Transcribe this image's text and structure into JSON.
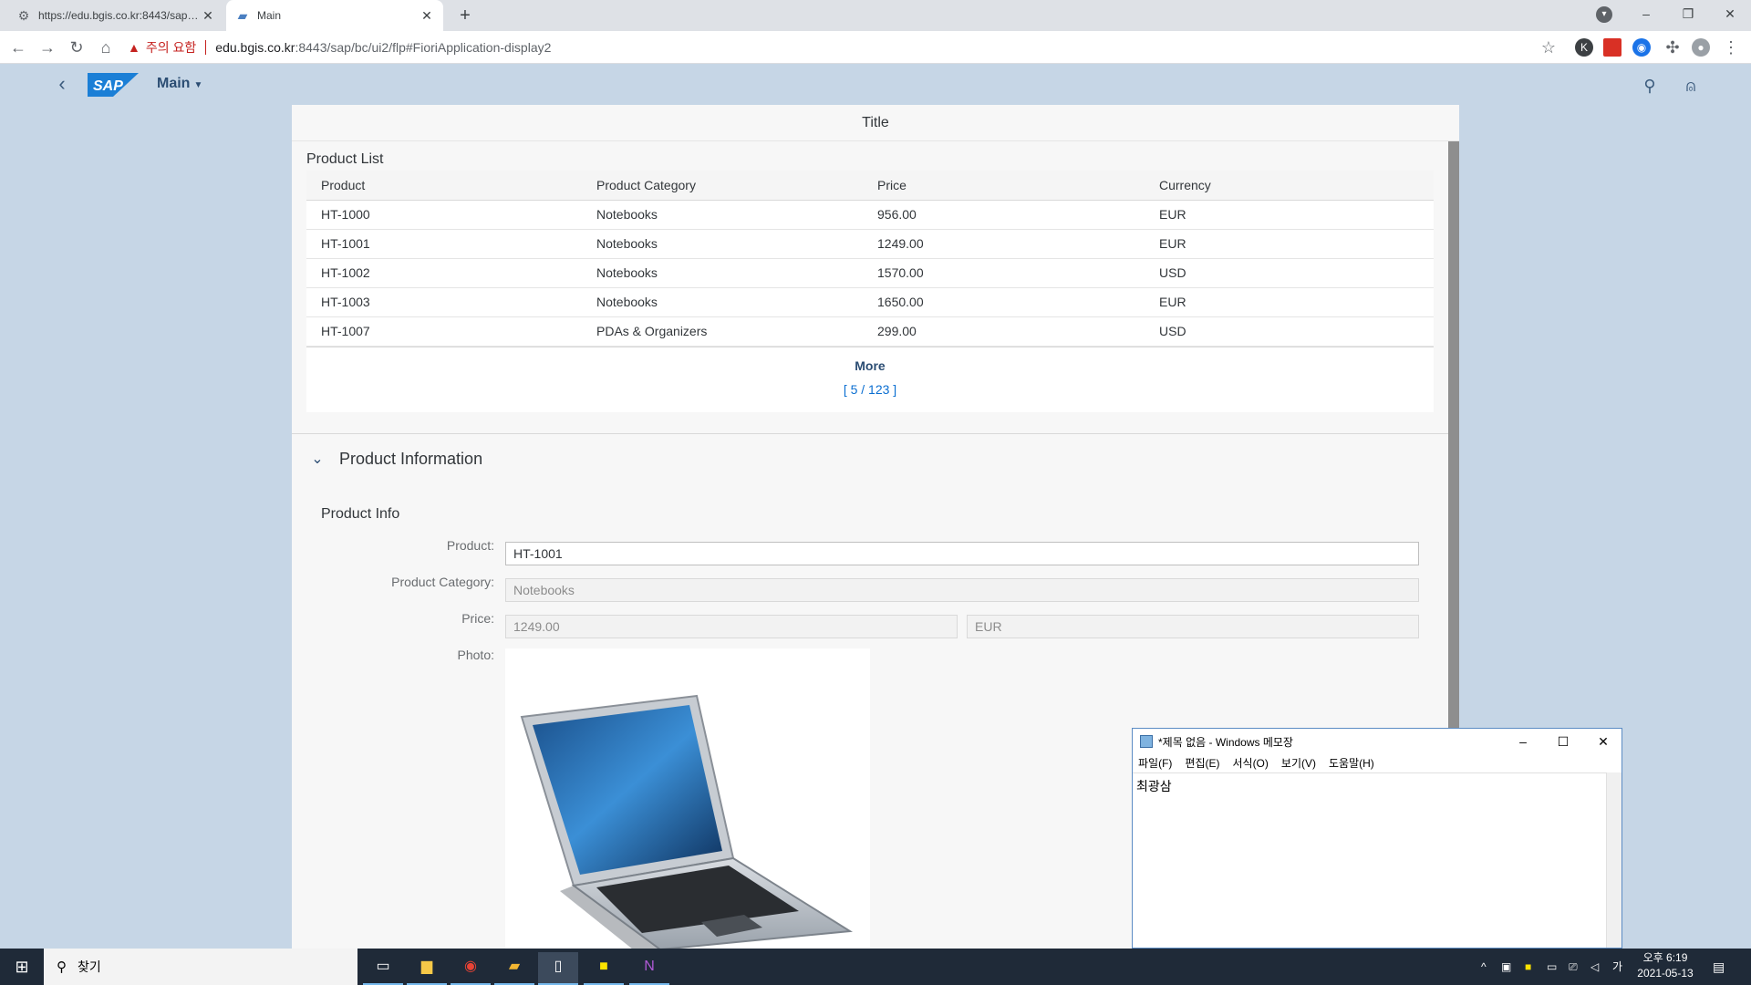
{
  "browser": {
    "tabs": [
      {
        "title": "https://edu.bgis.co.kr:8443/sap/bc/ui2/flp",
        "active": false
      },
      {
        "title": "Main",
        "active": true
      }
    ],
    "security_warning": "주의 요함",
    "url_host": "edu.bgis.co.kr",
    "url_path": ":8443/sap/bc/ui2/flp#FioriApplication-display2"
  },
  "shell": {
    "logo_text": "SAP",
    "menu_label": "Main"
  },
  "page": {
    "title": "Title",
    "product_list": {
      "title": "Product List",
      "columns": [
        "Product",
        "Product Category",
        "Price",
        "Currency"
      ],
      "rows": [
        [
          "HT-1000",
          "Notebooks",
          "956.00",
          "EUR"
        ],
        [
          "HT-1001",
          "Notebooks",
          "1249.00",
          "EUR"
        ],
        [
          "HT-1002",
          "Notebooks",
          "1570.00",
          "USD"
        ],
        [
          "HT-1003",
          "Notebooks",
          "1650.00",
          "EUR"
        ],
        [
          "HT-1007",
          "PDAs & Organizers",
          "299.00",
          "USD"
        ]
      ],
      "more_label": "More",
      "more_count": "[ 5 / 123 ]"
    },
    "product_info": {
      "panel_title": "Product Information",
      "form_title": "Product Info",
      "labels": {
        "product": "Product:",
        "category": "Product Category:",
        "price": "Price:",
        "photo": "Photo:"
      },
      "values": {
        "product": "HT-1001",
        "category": "Notebooks",
        "price": "1249.00",
        "currency": "EUR"
      }
    }
  },
  "notepad": {
    "title": "*제목 없음 - Windows 메모장",
    "menu": [
      "파일(F)",
      "편집(E)",
      "서식(O)",
      "보기(V)",
      "도움말(H)"
    ],
    "content": "최광삼"
  },
  "taskbar": {
    "search_placeholder": "찾기",
    "time": "오후 6:19",
    "date": "2021-05-13",
    "ime": "가"
  }
}
